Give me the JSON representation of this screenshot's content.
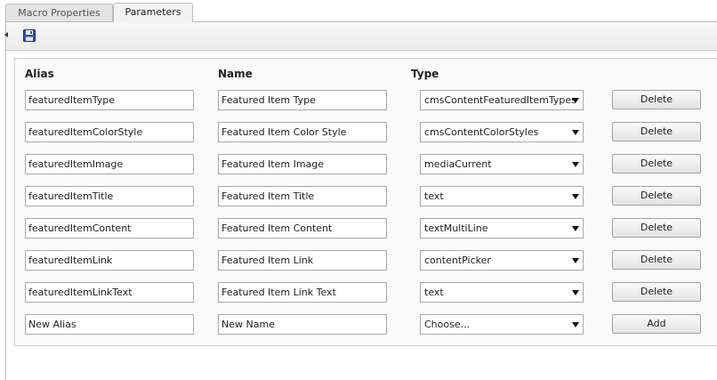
{
  "tabs": [
    {
      "label": "Macro Properties",
      "active": false
    },
    {
      "label": "Parameters",
      "active": true
    }
  ],
  "toolbar": {
    "back_icon": "back-arrow-icon",
    "save_icon": "save-icon"
  },
  "columns": {
    "alias": "Alias",
    "name": "Name",
    "type": "Type"
  },
  "rows": [
    {
      "alias": "featuredItemType",
      "name": "Featured Item Type",
      "type": "cmsContentFeaturedItemTypes",
      "action": "Delete"
    },
    {
      "alias": "featuredItemColorStyle",
      "name": "Featured Item Color Style",
      "type": "cmsContentColorStyles",
      "action": "Delete"
    },
    {
      "alias": "featuredItemImage",
      "name": "Featured Item Image",
      "type": "mediaCurrent",
      "action": "Delete"
    },
    {
      "alias": "featuredItemTitle",
      "name": "Featured Item Title",
      "type": "text",
      "action": "Delete"
    },
    {
      "alias": "featuredItemContent",
      "name": "Featured Item Content",
      "type": "textMultiLine",
      "action": "Delete"
    },
    {
      "alias": "featuredItemLink",
      "name": "Featured Item Link",
      "type": "contentPicker",
      "action": "Delete"
    },
    {
      "alias": "featuredItemLinkText",
      "name": "Featured Item Link Text",
      "type": "text",
      "action": "Delete"
    }
  ],
  "new_row": {
    "alias": "New Alias",
    "name": "New Name",
    "type": "Choose...",
    "action": "Add"
  }
}
